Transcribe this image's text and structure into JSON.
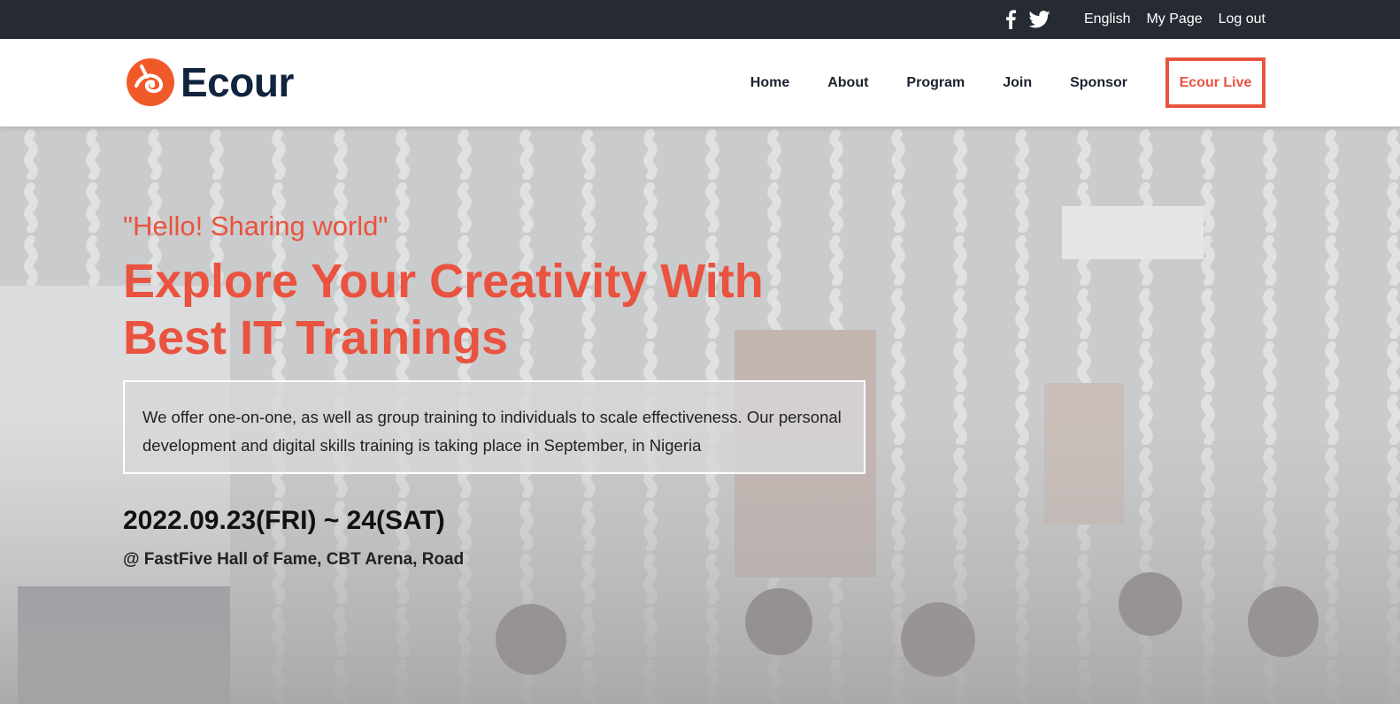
{
  "topbar": {
    "icons": [
      "facebook-icon",
      "twitter-icon"
    ],
    "links": [
      "English",
      "My Page",
      "Log out"
    ]
  },
  "header": {
    "logo_text": "Ecour",
    "nav": [
      "Home",
      "About",
      "Program",
      "Join",
      "Sponsor"
    ],
    "cta": "Ecour Live"
  },
  "hero": {
    "tagline": "\"Hello! Sharing world\"",
    "headline": "Explore Your Creativity With Best IT Trainings",
    "description": "We offer one-on-one, as well as group training to individuals to scale effectiveness. Our personal development and digital skills training is taking place in September, in Nigeria",
    "date": "2022.09.23(FRI) ~ 24(SAT)",
    "venue": "@ FastFive Hall of Fame, CBT Arena, Road"
  },
  "colors": {
    "accent": "#e9533f",
    "topbar_bg": "#262a33",
    "logo_text": "#10243e"
  }
}
